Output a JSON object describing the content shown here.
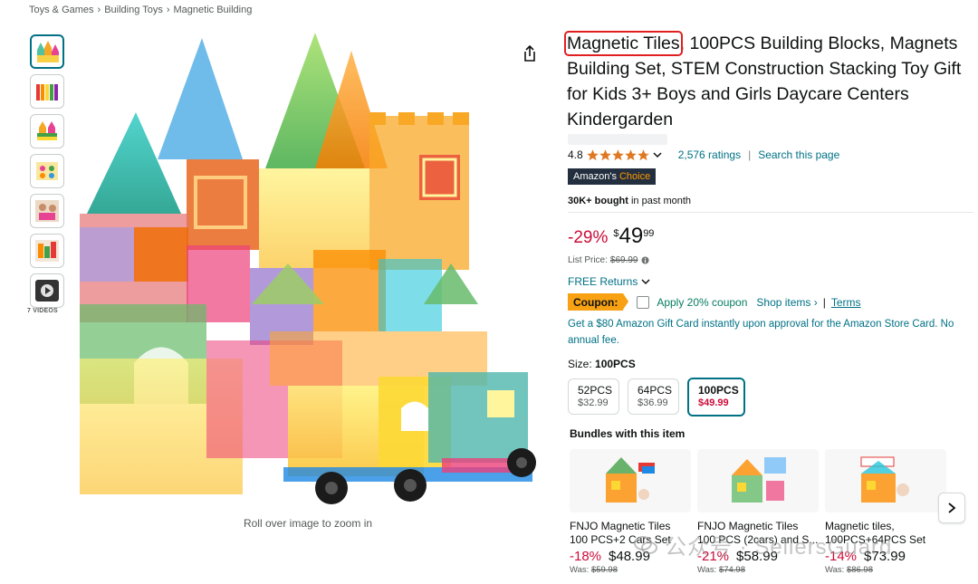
{
  "breadcrumb": [
    "Toys & Games",
    "Building Toys",
    "Magnetic Building"
  ],
  "breadcrumb_sep": "›",
  "gallery": {
    "thumbnails": [
      "thumb-castle",
      "thumb-rainbow-tiles",
      "thumb-castle-2",
      "thumb-box",
      "thumb-kids-playing",
      "thumb-tiles-colors",
      "thumb-video"
    ],
    "video_count": "7 VIDEOS",
    "zoom_hint": "Roll over image to zoom in"
  },
  "product": {
    "title_highlight": "Magnetic Tiles",
    "title_rest": ", 100PCS Building Blocks, Magnets Building Set, STEM Construction Stacking Toy Gift for Kids 3+ Boys and Girls Daycare Centers Kindergarden",
    "rating": "4.8",
    "stars": 4.8,
    "ratings_count": "2,576 ratings",
    "search_page": "Search this page",
    "badge_prefix": "Amazon's",
    "badge_accent": "Choice",
    "bought_bold": "30K+ bought",
    "bought_rest": " in past month"
  },
  "price": {
    "discount": "-29%",
    "currency": "$",
    "whole": "49",
    "fraction": "99",
    "list_label": "List Price:",
    "list_value": "$69.99"
  },
  "returns": "FREE Returns",
  "coupon": {
    "badge": "Coupon:",
    "apply": "Apply 20% coupon",
    "shop_items": "Shop items ›",
    "separator": "|",
    "terms": "Terms"
  },
  "gift_card": "Get a $80 Amazon Gift Card instantly upon approval for the Amazon Store Card. No annual fee.",
  "size": {
    "label": "Size:",
    "selected": "100PCS",
    "options": [
      {
        "name": "52PCS",
        "price": "$32.99"
      },
      {
        "name": "64PCS",
        "price": "$36.99"
      },
      {
        "name": "100PCS",
        "price": "$49.99"
      }
    ]
  },
  "bundles": {
    "title": "Bundles with this item",
    "items": [
      {
        "title": "FNJO Magnetic Tiles 100 PCS+2 Cars Set",
        "discount": "-18%",
        "price": "$48.99",
        "was_label": "Was:",
        "was": "$59.98"
      },
      {
        "title": "FNJO Magnetic Tiles 100 PCS (2cars) and S...",
        "discount": "-21%",
        "price": "$58.99",
        "was_label": "Was:",
        "was": "$74.98"
      },
      {
        "title": "Magnetic tiles, 100PCS+64PCS Set",
        "discount": "-14%",
        "price": "$73.99",
        "was_label": "Was:",
        "was": "$86.98"
      }
    ]
  },
  "watermark": "公众号 · SellersGuard",
  "colors": {
    "link": "#007185",
    "deal_red": "#cc0c39",
    "badge_dark": "#232f3e",
    "badge_orange": "#ff9900",
    "coupon_orange": "#f7a113",
    "green": "#067d62",
    "star": "#de7921",
    "highlight_box": "#e02020"
  }
}
